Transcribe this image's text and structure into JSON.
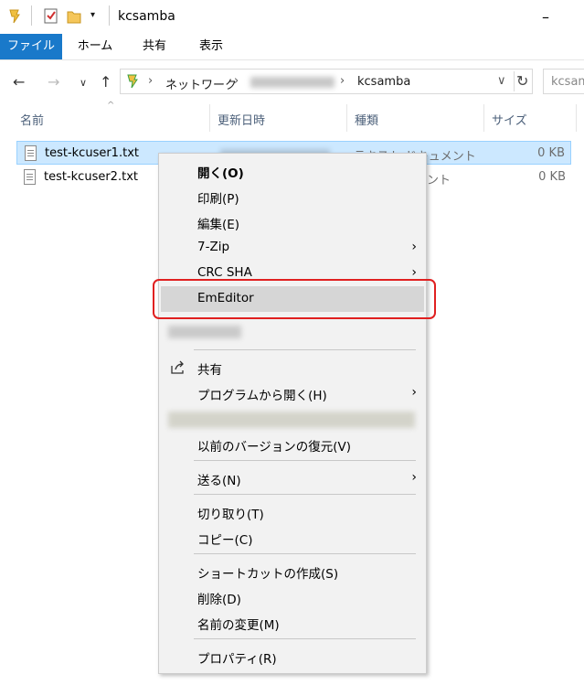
{
  "window": {
    "title": "kcsamba"
  },
  "ribbon": {
    "tabs": [
      "ファイル",
      "ホーム",
      "共有",
      "表示"
    ]
  },
  "address": {
    "segments": [
      "ネットワーク",
      "kcsamba"
    ],
    "search_placeholder": "kcsam"
  },
  "columns": {
    "name": "名前",
    "date": "更新日時",
    "type": "種類",
    "size": "サイズ"
  },
  "files": [
    {
      "name": "test-kcuser1.txt",
      "type": "テキスト ドキュメント",
      "size": "0 KB",
      "selected": true
    },
    {
      "name": "test-kcuser2.txt",
      "type": "メント",
      "size": "0 KB",
      "selected": false
    }
  ],
  "context_menu": {
    "items": [
      {
        "label": "開く(O)",
        "bold": true
      },
      {
        "label": "印刷(P)"
      },
      {
        "label": "編集(E)"
      },
      {
        "label": "7-Zip",
        "submenu": true
      },
      {
        "label": "CRC SHA",
        "submenu": true
      },
      {
        "label": "EmEditor",
        "highlighted": true
      },
      {
        "label": "共有",
        "icon": "share-icon"
      },
      {
        "label": "プログラムから開く(H)",
        "submenu": true
      },
      {
        "label": "以前のバージョンの復元(V)"
      },
      {
        "label": "送る(N)",
        "submenu": true
      },
      {
        "label": "切り取り(T)"
      },
      {
        "label": "コピー(C)"
      },
      {
        "label": "ショートカットの作成(S)"
      },
      {
        "label": "削除(D)"
      },
      {
        "label": "名前の変更(M)"
      },
      {
        "label": "プロパティ(R)"
      }
    ],
    "highlight_color": "#e02020"
  },
  "colors": {
    "accent": "#1979ca",
    "selection": "#cce8ff"
  }
}
